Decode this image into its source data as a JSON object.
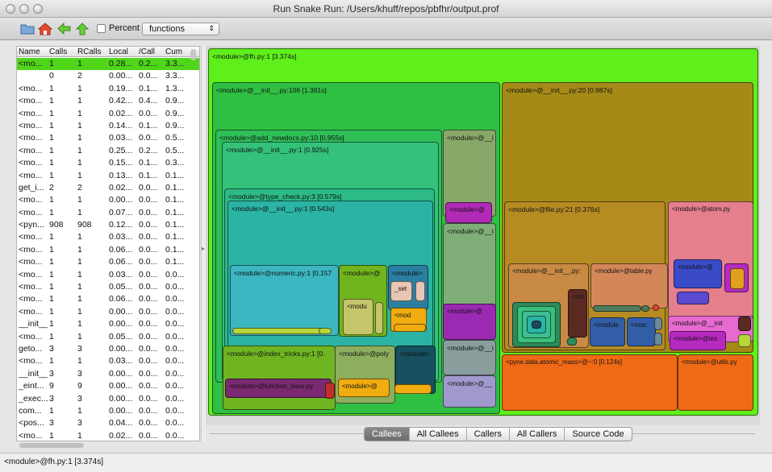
{
  "window": {
    "title": "Run Snake Run: /Users/khuff/repos/pbfhr/output.prof"
  },
  "toolbar": {
    "icons": [
      "open-folder-icon",
      "home-icon",
      "back-arrow-icon",
      "up-arrow-icon"
    ],
    "percent_label": "Percent",
    "percent_checked": false,
    "view_select": "functions"
  },
  "list": {
    "columns": [
      "Name",
      "Calls",
      "RCalls",
      "Local",
      "/Call",
      "Cum"
    ],
    "rows": [
      [
        "<mo...",
        "1",
        "1",
        "0.28...",
        "0.2...",
        "3.3..."
      ],
      [
        "",
        "0",
        "2",
        "0.00...",
        "0.0...",
        "3.3..."
      ],
      [
        "<mo...",
        "1",
        "1",
        "0.19...",
        "0.1...",
        "1.3..."
      ],
      [
        "<mo...",
        "1",
        "1",
        "0.42...",
        "0.4...",
        "0.9..."
      ],
      [
        "<mo...",
        "1",
        "1",
        "0.02...",
        "0.0...",
        "0.9..."
      ],
      [
        "<mo...",
        "1",
        "1",
        "0.14...",
        "0.1...",
        "0.9..."
      ],
      [
        "<mo...",
        "1",
        "1",
        "0.03...",
        "0.0...",
        "0.5..."
      ],
      [
        "<mo...",
        "1",
        "1",
        "0.25...",
        "0.2...",
        "0.5..."
      ],
      [
        "<mo...",
        "1",
        "1",
        "0.15...",
        "0.1...",
        "0.3..."
      ],
      [
        "<mo...",
        "1",
        "1",
        "0.13...",
        "0.1...",
        "0.1..."
      ],
      [
        "get_i...",
        "2",
        "2",
        "0.02...",
        "0.0...",
        "0.1..."
      ],
      [
        "<mo...",
        "1",
        "1",
        "0.00...",
        "0.0...",
        "0.1..."
      ],
      [
        "<mo...",
        "1",
        "1",
        "0.07...",
        "0.0...",
        "0.1..."
      ],
      [
        "<pyn...",
        "908",
        "908",
        "0.12...",
        "0.0...",
        "0.1..."
      ],
      [
        "<mo...",
        "1",
        "1",
        "0.03...",
        "0.0...",
        "0.1..."
      ],
      [
        "<mo...",
        "1",
        "1",
        "0.06...",
        "0.0...",
        "0.1..."
      ],
      [
        "<mo...",
        "1",
        "1",
        "0.06...",
        "0.0...",
        "0.1..."
      ],
      [
        "<mo...",
        "1",
        "1",
        "0.03...",
        "0.0...",
        "0.0..."
      ],
      [
        "<mo...",
        "1",
        "1",
        "0.05...",
        "0.0...",
        "0.0..."
      ],
      [
        "<mo...",
        "1",
        "1",
        "0.06...",
        "0.0...",
        "0.0..."
      ],
      [
        "<mo...",
        "1",
        "1",
        "0.00...",
        "0.0...",
        "0.0..."
      ],
      [
        "__init__",
        "1",
        "1",
        "0.00...",
        "0.0...",
        "0.0..."
      ],
      [
        "<mo...",
        "1",
        "1",
        "0.05...",
        "0.0...",
        "0.0..."
      ],
      [
        "geto...",
        "3",
        "3",
        "0.00...",
        "0.0...",
        "0.0..."
      ],
      [
        "<mo...",
        "1",
        "1",
        "0.03...",
        "0.0...",
        "0.0..."
      ],
      [
        "__init__",
        "3",
        "3",
        "0.00...",
        "0.0...",
        "0.0..."
      ],
      [
        "_eint...",
        "9",
        "9",
        "0.00...",
        "0.0...",
        "0.0..."
      ],
      [
        "_exec...",
        "3",
        "3",
        "0.00...",
        "0.0...",
        "0.0..."
      ],
      [
        "com...",
        "1",
        "1",
        "0.00...",
        "0.0...",
        "0.0..."
      ],
      [
        "<pos...",
        "3",
        "3",
        "0.04...",
        "0.0...",
        "0.0..."
      ],
      [
        "<mo...",
        "1",
        "1",
        "0.02...",
        "0.0...",
        "0.0..."
      ],
      [
        "<mo...",
        "1",
        "1",
        "0.03...",
        "0.0...",
        "0.0..."
      ],
      [
        "<mo...",
        "1",
        "1",
        "0.01...",
        "0.0...",
        "0.0..."
      ],
      [
        "<mo...",
        "1",
        "1",
        "0.01...",
        "0.0...",
        "0.0..."
      ],
      [
        "<mo...",
        "1",
        "1",
        "0.00...",
        "0.0...",
        "0.0..."
      ]
    ]
  },
  "map": {
    "blocks": [
      {
        "label": "<module>@fh.py:1 [3.374s]",
        "color": "#5ff01c"
      },
      {
        "label": "<module>@__init__.py:106 [1.381s]",
        "color": "#2fbf43"
      },
      {
        "label": "<module>@__init__.py:20 [0.987s]",
        "color": "#a58a17"
      },
      {
        "label": "<module>@add_newdocs.py:10 [0.955s]",
        "color": "#2fbf57"
      },
      {
        "label": "<module>@__init__.py:1 [0.925s]",
        "color": "#34c27a"
      },
      {
        "label": "<module>@type_check.py:3 [0.579s]",
        "color": "#2dba85"
      },
      {
        "label": "<module>@__init__.py:1 [0.543s]",
        "color": "#2bb3a3"
      },
      {
        "label": "<module>@numeric.py:1 [0.157",
        "color": "#3cb6c0"
      },
      {
        "label": "<module>@",
        "color": "#70b41e"
      },
      {
        "label": "<module>",
        "color": "#2a7fa0"
      },
      {
        "label": "_set",
        "color": "#e8c6b5"
      },
      {
        "label": "<modu",
        "color": "#c5c56a"
      },
      {
        "label": "<mod",
        "color": "#f0ac10"
      },
      {
        "label": "<module>@__i",
        "color": "#88a86a"
      },
      {
        "label": "<module>@",
        "color": "#b02ab5"
      },
      {
        "label": "<module>@__i",
        "color": "#7fae78"
      },
      {
        "label": "<module>@",
        "color": "#9b2ab3"
      },
      {
        "label": "<module>@__i",
        "color": "#8a9e9e"
      },
      {
        "label": "<module>@__",
        "color": "#a09acc"
      },
      {
        "label": "<module>@index_tricks.py:1 [0.",
        "color": "#6fb421"
      },
      {
        "label": "<module>@function_base.py",
        "color": "#7a2a72"
      },
      {
        "label": "<module>@poly",
        "color": "#8cae5e"
      },
      {
        "label": "<module>@",
        "color": "#f0ac10"
      },
      {
        "label": "<module>",
        "color": "#17505f"
      },
      {
        "label": "<module>@file.py:21 [0.376s]",
        "color": "#b58b22"
      },
      {
        "label": "<module>@__init__.py:",
        "color": "#c88a45"
      },
      {
        "label": "<module>@table.py",
        "color": "#d38759"
      },
      {
        "label": "<mo",
        "color": "#5a2a22"
      },
      {
        "label": "<module",
        "color": "#325ea8"
      },
      {
        "label": "<moc",
        "color": "#325ea8"
      },
      {
        "label": "<module>@atom.py",
        "color": "#e57f8c"
      },
      {
        "label": "<module>@",
        "color": "#3a4bc8"
      },
      {
        "label": "<module>@__init",
        "color": "#e66ad0"
      },
      {
        "label": "<module>@tes",
        "color": "#b62ac0"
      },
      {
        "label": "<pyne.data.atomic_mass>@~:0 [0.124s]",
        "color": "#f06a16"
      },
      {
        "label": "<module>@utils.py",
        "color": "#f06a16"
      }
    ]
  },
  "tabs": [
    "Callees",
    "All Callees",
    "Callers",
    "All Callers",
    "Source Code"
  ],
  "active_tab": "Callees",
  "status": "<module>@fh.py:1 [3.374s]"
}
